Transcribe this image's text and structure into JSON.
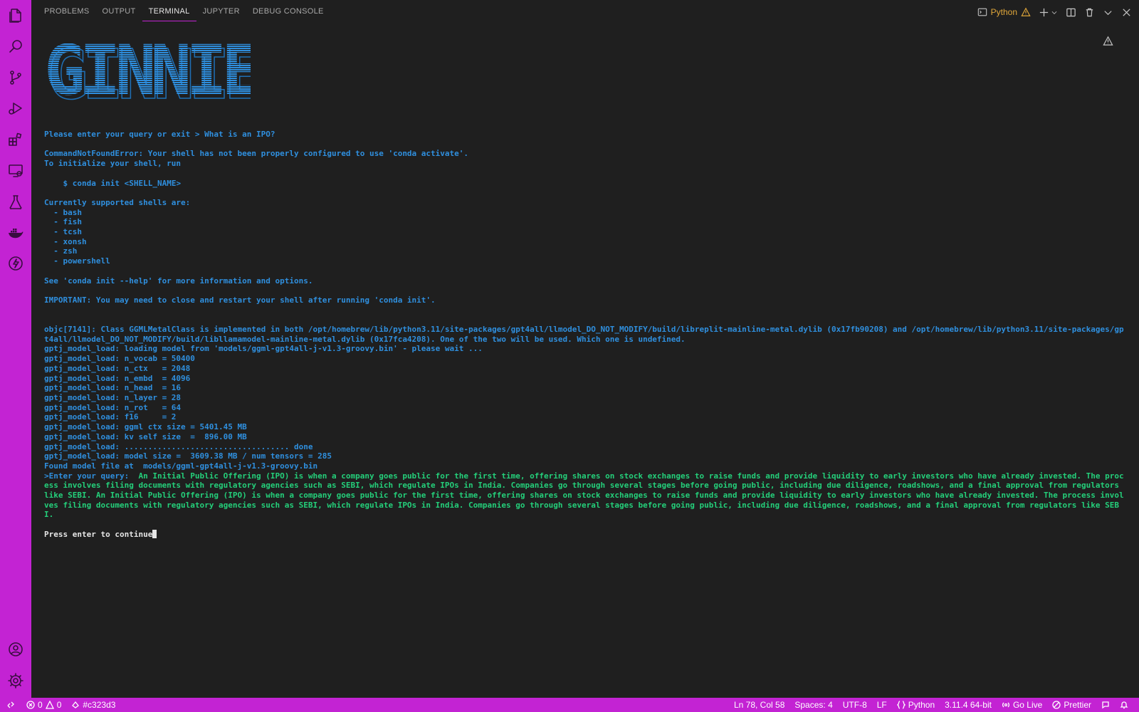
{
  "panel": {
    "tabs": [
      "PROBLEMS",
      "OUTPUT",
      "TERMINAL",
      "JUPYTER",
      "DEBUG CONSOLE"
    ],
    "active_tab": "TERMINAL",
    "terminal_profile": "Python"
  },
  "terminal": {
    "banner_text": "GINNIE",
    "query_block": "Please enter your query or exit > What is an IPO?\n\nCommandNotFoundError: Your shell has not been properly configured to use 'conda activate'.\nTo initialize your shell, run\n\n    $ conda init <SHELL_NAME>\n\nCurrently supported shells are:\n  - bash\n  - fish\n  - tcsh\n  - xonsh\n  - zsh\n  - powershell\n\nSee 'conda init --help' for more information and options.\n\nIMPORTANT: You may need to close and restart your shell after running 'conda init'.\n\n\nobjc[7141]: Class GGMLMetalClass is implemented in both /opt/homebrew/lib/python3.11/site-packages/gpt4all/llmodel_DO_NOT_MODIFY/build/libreplit-mainline-metal.dylib (0x17fb90208) and /opt/homebrew/lib/python3.11/site-packages/gpt4all/llmodel_DO_NOT_MODIFY/build/libllamamodel-mainline-metal.dylib (0x17fca4208). One of the two will be used. Which one is undefined.\ngptj_model_load: loading model from 'models/ggml-gpt4all-j-v1.3-groovy.bin' - please wait ...\ngptj_model_load: n_vocab = 50400\ngptj_model_load: n_ctx   = 2048\ngptj_model_load: n_embd  = 4096\ngptj_model_load: n_head  = 16\ngptj_model_load: n_layer = 28\ngptj_model_load: n_rot   = 64\ngptj_model_load: f16     = 2\ngptj_model_load: ggml ctx size = 5401.45 MB\ngptj_model_load: kv self size  =  896.00 MB\ngptj_model_load: ................................... done\ngptj_model_load: model size =  3609.38 MB / num tensors = 285\nFound model file at  models/ggml-gpt4all-j-v1.3-groovy.bin\n>Enter your query:  ",
    "answer": "An Initial Public Offering (IPO) is when a company goes public for the first time, offering shares on stock exchanges to raise funds and provide liquidity to early investors who have already invested. The process involves filing documents with regulatory agencies such as SEBI, which regulate IPOs in India. Companies go through several stages before going public, including due diligence, roadshows, and a final approval from regulators like SEBI. An Initial Public Offering (IPO) is when a company goes public for the first time, offering shares on stock exchanges to raise funds and provide liquidity to early investors who have already invested. The process involves filing documents with regulatory agencies such as SEBI, which regulate IPOs in India. Companies go through several stages before going public, including due diligence, roadshows, and a final approval from regulators like SEBI.",
    "prompt": "Press enter to continue"
  },
  "statusbar": {
    "errors": "0",
    "warnings": "0",
    "branch": "#c323d3",
    "cursor_pos": "Ln 78, Col 58",
    "spaces": "Spaces: 4",
    "encoding": "UTF-8",
    "eol": "LF",
    "language": "Python",
    "interpreter": "3.11.4 64-bit",
    "golive": "Go Live",
    "prettier": "Prettier"
  },
  "colors": {
    "accent": "#c323d3",
    "terminal_blue": "#2f8fde",
    "terminal_green": "#24cf7a",
    "background": "#1f1f1f",
    "profile_warning": "#e0a73a"
  },
  "icons": {
    "activity_bar": [
      "files-icon",
      "search-icon",
      "source-control-icon",
      "run-debug-icon",
      "extensions-icon",
      "remote-explorer-icon",
      "testing-icon",
      "docker-icon",
      "lightning-icon",
      "account-icon",
      "settings-gear-icon"
    ]
  }
}
